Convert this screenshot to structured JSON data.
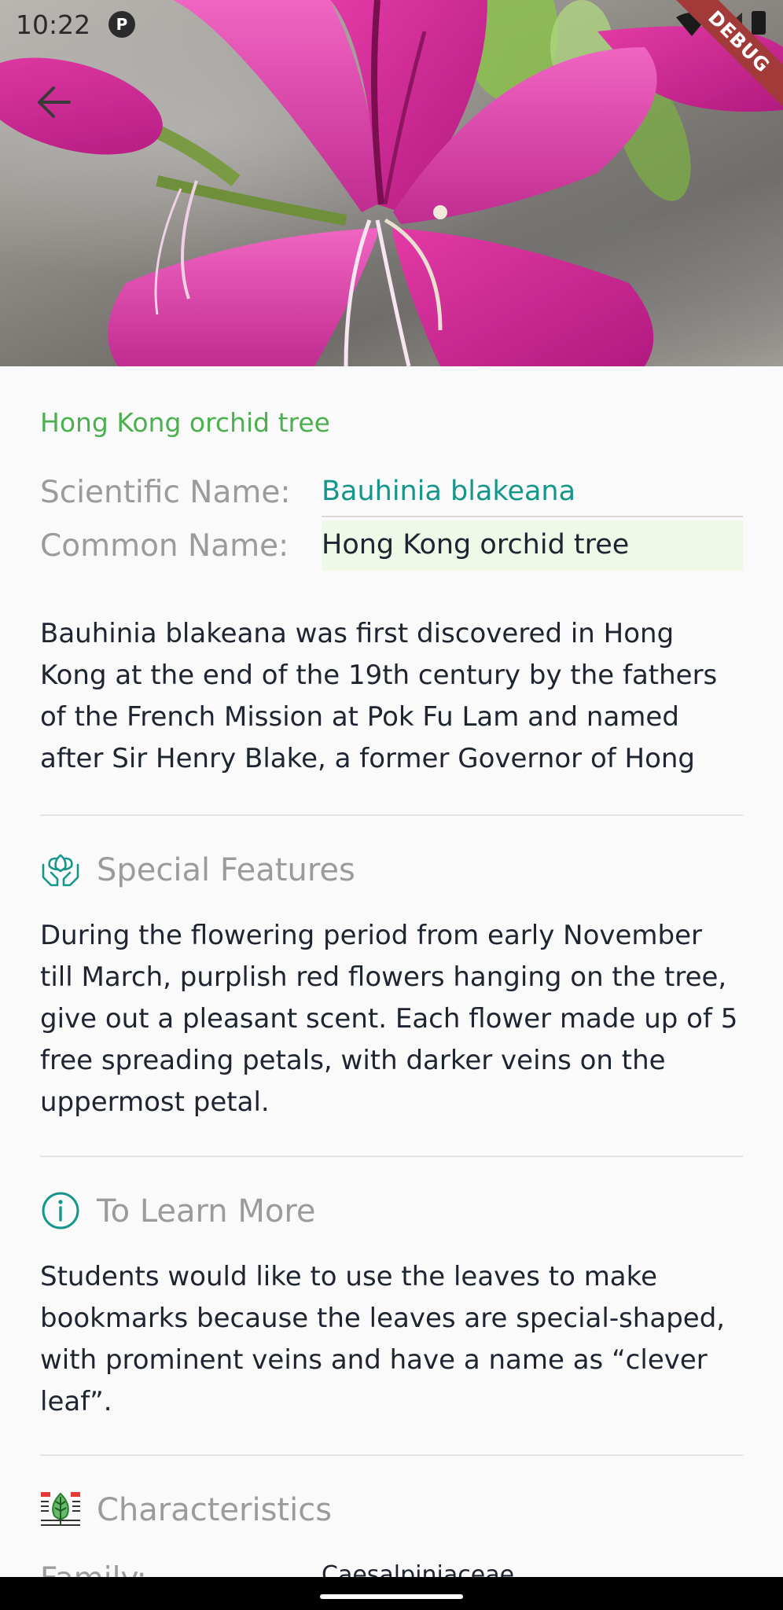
{
  "status_bar": {
    "time": "10:22",
    "notification_icon": "p-badge-icon",
    "wifi_icon": "wifi-icon",
    "signal_icon": "signal-icon",
    "battery_icon": "battery-icon",
    "debug_label": "DEBUG"
  },
  "header": {
    "back_icon": "arrow-left-icon",
    "hero_image": "bauhinia-flower-photo"
  },
  "plant": {
    "title": "Hong Kong orchid tree",
    "scientific_label": "Scientific Name:",
    "scientific_value": "Bauhinia blakeana",
    "common_label": "Common Name:",
    "common_value": "Hong Kong orchid tree",
    "intro": "Bauhinia blakeana was first discovered in Hong Kong at the end of the 19th century by the fathers of the French Mission at Pok Fu Lam and named after Sir Henry Blake, a former Governor of Hong Kong. It w..."
  },
  "sections": {
    "special": {
      "icon": "hands-leaf-icon",
      "title": "Special Features",
      "body": "During the flowering period from early November till March, purplish red flowers hanging on the tree, give out a pleasant scent. Each flower made up of 5 free spreading petals, with darker veins on the uppermost petal."
    },
    "learn": {
      "icon": "info-circle-icon",
      "title": "To Learn More",
      "body": "Students would like to use the leaves to make bookmarks because the leaves are special-shaped, with prominent veins and have a name as “clever leaf”."
    },
    "characteristics": {
      "icon": "leaf-chart-icon",
      "title": "Characteristics",
      "family_label": "Family:",
      "family_value": "Caesalpiniaceae"
    }
  },
  "colors": {
    "accent_green": "#4caf50",
    "teal": "#16968a",
    "label_gray": "#9b9b9b",
    "text": "#1f2431",
    "highlight": "#f0f8e8"
  }
}
